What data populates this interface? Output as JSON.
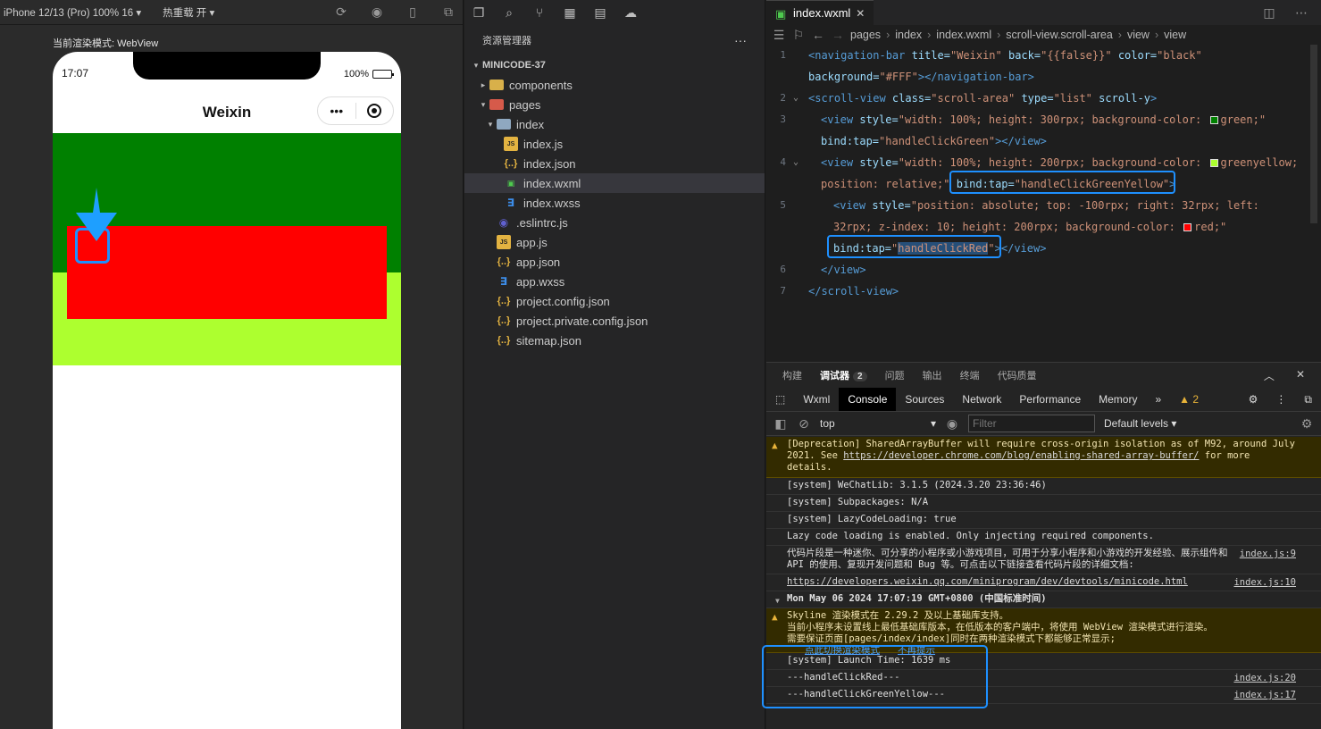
{
  "simulator": {
    "device_select": "iPhone 12/13 (Pro) 100% 16",
    "hot_reload": "热重载 开",
    "render_mode": "当前渲染模式: WebView",
    "status_time": "17:07",
    "battery_text": "100%",
    "battery_level": 0.92,
    "nav_title": "Weixin",
    "capsule_more": "•••",
    "colors": {
      "green": "#008000",
      "greenyellow": "#adff2f",
      "red": "#ff0000",
      "highlight": "#1e90ff"
    }
  },
  "explorer": {
    "header": "资源管理器",
    "more": "···",
    "root": "MINICODE-37",
    "items": [
      {
        "label": "components",
        "type": "folder",
        "depth": 1,
        "chev": "▸",
        "color": "#d8b04a"
      },
      {
        "label": "pages",
        "type": "folder",
        "depth": 1,
        "chev": "▾",
        "color": "#d65a4a"
      },
      {
        "label": "index",
        "type": "folder",
        "depth": 2,
        "chev": "▾",
        "color": "#8fa8c0"
      },
      {
        "label": "index.js",
        "type": "js",
        "depth": 3,
        "chev": ""
      },
      {
        "label": "index.json",
        "type": "json",
        "depth": 3,
        "chev": ""
      },
      {
        "label": "index.wxml",
        "type": "wxml",
        "depth": 3,
        "chev": "",
        "active": true
      },
      {
        "label": "index.wxss",
        "type": "wxss",
        "depth": 3,
        "chev": ""
      },
      {
        "label": ".eslintrc.js",
        "type": "eslint",
        "depth": 2,
        "chev": ""
      },
      {
        "label": "app.js",
        "type": "js",
        "depth": 2,
        "chev": ""
      },
      {
        "label": "app.json",
        "type": "json",
        "depth": 2,
        "chev": ""
      },
      {
        "label": "app.wxss",
        "type": "wxss",
        "depth": 2,
        "chev": ""
      },
      {
        "label": "project.config.json",
        "type": "json",
        "depth": 2,
        "chev": ""
      },
      {
        "label": "project.private.config.json",
        "type": "json",
        "depth": 2,
        "chev": ""
      },
      {
        "label": "sitemap.json",
        "type": "json",
        "depth": 2,
        "chev": ""
      }
    ]
  },
  "editor": {
    "tab_label": "index.wxml",
    "tab_close": "✕",
    "breadcrumb": [
      "pages",
      "index",
      "index.wxml",
      "scroll-view.scroll-area",
      "view",
      "view"
    ],
    "lines": [
      {
        "num": "1",
        "fold": "",
        "indent": 0,
        "tokens": [
          [
            "t-tag",
            "<navigation-bar "
          ],
          [
            "t-attr",
            "title="
          ],
          [
            "t-str",
            "\"Weixin\" "
          ],
          [
            "t-attr",
            "back="
          ],
          [
            "t-str",
            "\"{{false}}\" "
          ],
          [
            "t-attr",
            "color="
          ],
          [
            "t-str",
            "\"black\""
          ]
        ]
      },
      {
        "num": "",
        "fold": "",
        "indent": 0,
        "tokens": [
          [
            "t-attr",
            "background="
          ],
          [
            "t-str",
            "\"#FFF\""
          ],
          [
            "t-tag",
            "></navigation-bar>"
          ]
        ]
      },
      {
        "num": "2",
        "fold": "⌄",
        "indent": 0,
        "tokens": [
          [
            "t-tag",
            "<scroll-view "
          ],
          [
            "t-attr",
            "class="
          ],
          [
            "t-str",
            "\"scroll-area\" "
          ],
          [
            "t-attr",
            "type="
          ],
          [
            "t-str",
            "\"list\" "
          ],
          [
            "t-attr",
            "scroll-y"
          ],
          [
            "t-tag",
            ">"
          ]
        ]
      },
      {
        "num": "3",
        "fold": "",
        "indent": 1,
        "tokens": [
          [
            "t-tag",
            "<view "
          ],
          [
            "t-attr",
            "style="
          ],
          [
            "t-str",
            "\"width: 100%; height: 300rpx; background-color: "
          ],
          [
            "sw",
            "#008000"
          ],
          [
            "t-str",
            "green;\""
          ]
        ]
      },
      {
        "num": "",
        "fold": "",
        "indent": 1,
        "tokens": [
          [
            "t-attr",
            "bind:tap="
          ],
          [
            "t-str",
            "\"handleClickGreen\""
          ],
          [
            "t-tag",
            "></view>"
          ]
        ]
      },
      {
        "num": "4",
        "fold": "⌄",
        "indent": 1,
        "tokens": [
          [
            "t-tag",
            "<view "
          ],
          [
            "t-attr",
            "style="
          ],
          [
            "t-str",
            "\"width: 100%; height: 200rpx; background-color: "
          ],
          [
            "sw",
            "#adff2f"
          ],
          [
            "t-str",
            "greenyellow;"
          ]
        ]
      },
      {
        "num": "",
        "fold": "",
        "indent": 1,
        "tokens": [
          [
            "t-str",
            "position: relative;\" "
          ],
          [
            "t-attr",
            "bind:tap="
          ],
          [
            "t-str",
            "\"handleClickGreenYellow\""
          ],
          [
            "t-tag",
            ">"
          ]
        ]
      },
      {
        "num": "5",
        "fold": "",
        "indent": 2,
        "tokens": [
          [
            "t-tag",
            "<view "
          ],
          [
            "t-attr",
            "style="
          ],
          [
            "t-str",
            "\"position: absolute; top: -100rpx; right: 32rpx; left:"
          ]
        ]
      },
      {
        "num": "",
        "fold": "",
        "indent": 2,
        "tokens": [
          [
            "t-str",
            "32rpx; z-index: 10; height: 200rpx; background-color: "
          ],
          [
            "sw",
            "#ff0000"
          ],
          [
            "t-str",
            "red;\""
          ]
        ]
      },
      {
        "num": "",
        "fold": "",
        "indent": 2,
        "tokens": [
          [
            "t-attr",
            "bind:tap="
          ],
          [
            "t-str",
            "\""
          ],
          [
            "sel",
            "handleClickRed"
          ],
          [
            "t-str",
            "\""
          ],
          [
            "t-tag",
            "></view>"
          ]
        ]
      },
      {
        "num": "6",
        "fold": "",
        "indent": 1,
        "tokens": [
          [
            "t-tag",
            "</view>"
          ]
        ]
      },
      {
        "num": "7",
        "fold": "",
        "indent": 0,
        "tokens": [
          [
            "t-tag",
            "</scroll-view>"
          ]
        ]
      }
    ]
  },
  "devtools": {
    "panels": [
      {
        "label": "构建"
      },
      {
        "label": "调试器",
        "active": true,
        "badge": "2"
      },
      {
        "label": "问题"
      },
      {
        "label": "输出"
      },
      {
        "label": "终端"
      },
      {
        "label": "代码质量"
      }
    ],
    "tabs": [
      "Wxml",
      "Console",
      "Sources",
      "Network",
      "Performance",
      "Memory"
    ],
    "active_tab": "Console",
    "more_tabs": "»",
    "warn_count": "2",
    "context": "top",
    "filter_placeholder": "Filter",
    "levels": "Default levels ▾",
    "logs": [
      {
        "kind": "warn",
        "text": "[Deprecation] SharedArrayBuffer will require cross-origin isolation as of M92, around July 2021. See ",
        "link": "https://developer.chrome.com/blog/enabling-shared-array-buffer/",
        "tail": " for more details.",
        "src": ""
      },
      {
        "kind": "info",
        "text": "[system] WeChatLib: 3.1.5 (2024.3.20 23:36:46)",
        "src": ""
      },
      {
        "kind": "info",
        "text": "[system] Subpackages: N/A",
        "src": ""
      },
      {
        "kind": "info",
        "text": "[system] LazyCodeLoading: true",
        "src": ""
      },
      {
        "kind": "info",
        "text": "Lazy code loading is enabled. Only injecting required components.",
        "src": ""
      },
      {
        "kind": "info",
        "text": "代码片段是一种迷你、可分享的小程序或小游戏项目，可用于分享小程序和小游戏的开发经验、展示组件和 API 的使用、复现开发问题和 Bug 等。可点击以下链接查看代码片段的详细文档:",
        "src": "index.js:9"
      },
      {
        "kind": "info",
        "text": "",
        "link": "https://developers.weixin.qq.com/miniprogram/dev/devtools/minicode.html",
        "src": "index.js:10"
      },
      {
        "kind": "group",
        "text": "Mon May 06 2024 17:07:19 GMT+0800 (中国标准时间)",
        "src": ""
      },
      {
        "kind": "warn",
        "text": "Skyline 渲染模式在 2.29.2 及以上基础库支持。\n当前小程序未设置线上最低基础库版本，在低版本的客户端中，将使用 WebView 渲染模式进行渲染。\n需要保证页面[pages/index/index]同时在两种渲染模式下都能够正常显示;",
        "actions": [
          "点此切换渲染模式",
          "不再提示"
        ],
        "src": ""
      },
      {
        "kind": "info",
        "text": "[system] Launch Time: 1639 ms",
        "src": ""
      },
      {
        "kind": "info",
        "text": "---handleClickRed---",
        "src": "index.js:20"
      },
      {
        "kind": "info",
        "text": "---handleClickGreenYellow---",
        "src": "index.js:17"
      }
    ]
  }
}
